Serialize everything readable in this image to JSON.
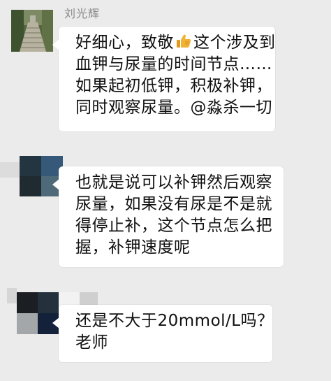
{
  "messages": [
    {
      "sender": "刘光辉",
      "avatar": "stone-path-photo-avatar",
      "line1_before_emoji": "好细心，致敬",
      "emoji": "thumbs-up-icon",
      "line1_after_emoji": "这个涉及到",
      "line2": "血钾与尿量的时间节点……",
      "line3": "如果起初低钾，积极补钾，",
      "line4": "同时观察尿量。@淼杀一切"
    },
    {
      "avatar": "pixelated-avatar",
      "line1": "也就是说可以补钾然后观察",
      "line2": "尿量，如果没有尿是不是就",
      "line3": "得停止补，这个节点怎么把",
      "line4": "握，补钾速度呢"
    },
    {
      "avatar": "pixelated-avatar",
      "line1": "还是不大于20mmol/L吗？",
      "line2": "老师"
    }
  ],
  "colors": {
    "background": "#ebebeb",
    "bubble": "#ffffff",
    "sender_name": "#8a8a8a",
    "text": "#111111",
    "thumb": "#f2b233"
  }
}
